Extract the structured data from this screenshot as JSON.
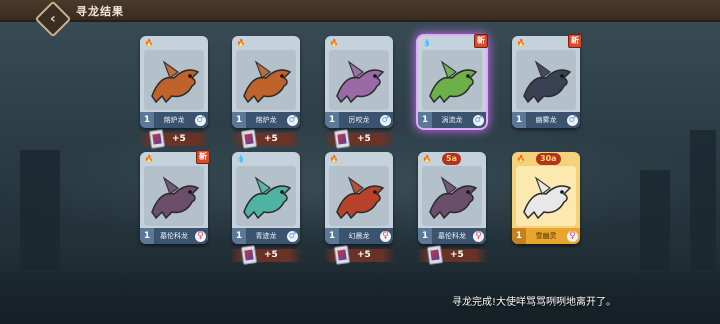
{
  "header": {
    "title": "寻龙结果",
    "back_icon": "back-arrow-icon"
  },
  "cards": [
    {
      "name": "熔炉龙",
      "level": "1",
      "element": "fire",
      "gender": "male",
      "is_new": false,
      "highlight": false,
      "reward": "+5",
      "dup": "",
      "color": "#c0632a"
    },
    {
      "name": "熔炉龙",
      "level": "1",
      "element": "fire",
      "gender": "male",
      "is_new": false,
      "highlight": false,
      "reward": "+5",
      "dup": "",
      "color": "#c0632a"
    },
    {
      "name": "厉咬龙",
      "level": "1",
      "element": "fire",
      "gender": "male",
      "is_new": false,
      "highlight": false,
      "reward": "+5",
      "dup": "",
      "color": "#9a6aa6"
    },
    {
      "name": "涡流龙",
      "level": "1",
      "element": "water",
      "gender": "male",
      "is_new": true,
      "highlight": true,
      "reward": "",
      "dup": "",
      "color": "#6db04a"
    },
    {
      "name": "幽雾龙",
      "level": "1",
      "element": "fire",
      "gender": "male",
      "is_new": true,
      "highlight": false,
      "reward": "",
      "dup": "",
      "color": "#3a4152"
    },
    {
      "name": "墓伦科龙",
      "level": "1",
      "element": "fire",
      "gender": "female",
      "is_new": true,
      "highlight": false,
      "reward": "",
      "dup": "",
      "color": "#6a4e6a"
    },
    {
      "name": "青迹龙",
      "level": "1",
      "element": "water",
      "gender": "male",
      "is_new": false,
      "highlight": false,
      "reward": "+5",
      "dup": "",
      "color": "#4fb3a2"
    },
    {
      "name": "幻晨龙",
      "level": "1",
      "element": "fire",
      "gender": "female",
      "is_new": false,
      "highlight": false,
      "reward": "+5",
      "dup": "",
      "color": "#b8432a"
    },
    {
      "name": "墓伦科龙",
      "level": "1",
      "element": "fire",
      "gender": "female",
      "is_new": false,
      "highlight": false,
      "reward": "+5",
      "dup": "5a",
      "color": "#6a4e6a"
    },
    {
      "name": "雪幽灵",
      "level": "1",
      "element": "fire",
      "gender": "female",
      "is_new": false,
      "highlight": false,
      "reward": "",
      "dup": "30a",
      "gold": true,
      "color": "#e8e8e8"
    }
  ],
  "message": "寻龙完成!大使咩骂骂咧咧地离开了。",
  "colors": {
    "topbar": "#3a2c20",
    "card_bg": "#c6d2db",
    "name_bar": "#3c5370",
    "gold_card": "#f3d27a",
    "highlight_glow": "#e6a8ff"
  }
}
